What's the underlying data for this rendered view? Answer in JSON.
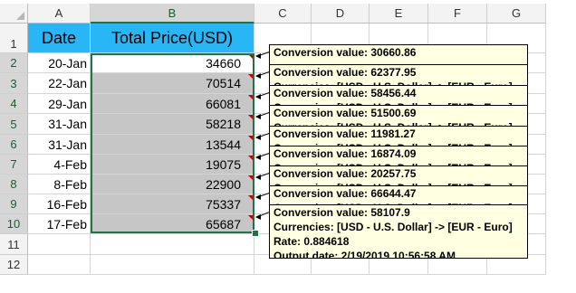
{
  "columns": [
    "A",
    "B",
    "C",
    "D",
    "E",
    "F",
    "G"
  ],
  "rows": [
    "1",
    "2",
    "3",
    "4",
    "5",
    "6",
    "7",
    "8",
    "9",
    "10",
    "11",
    "12"
  ],
  "header": {
    "date": "Date",
    "price": "Total Price(USD)"
  },
  "header_fill": "#29b6f6",
  "selection_color": "#217346",
  "table": [
    {
      "date": "20-Jan",
      "price": "34660"
    },
    {
      "date": "22-Jan",
      "price": "70514"
    },
    {
      "date": "29-Jan",
      "price": "66081"
    },
    {
      "date": "31-Jan",
      "price": "58218"
    },
    {
      "date": "31-Jan",
      "price": "13544"
    },
    {
      "date": "4-Feb",
      "price": "19075"
    },
    {
      "date": "8-Feb",
      "price": "22900"
    },
    {
      "date": "16-Feb",
      "price": "75337"
    },
    {
      "date": "17-Feb",
      "price": "65687"
    }
  ],
  "comments": [
    {
      "line1": "Conversion value: 30660.86",
      "line2": ""
    },
    {
      "line1": "Conversion value: 62377.95",
      "line2": "Currencies: [USD - U.S. Dollar] -> [EUR - Euro]"
    },
    {
      "line1": "Conversion value: 58456.44",
      "line2": "Currencies: [USD - U.S. Dollar] -> [EUR - Euro]"
    },
    {
      "line1": "Conversion value: 51500.69",
      "line2": "Currencies: [USD - U.S. Dollar] -> [EUR - Euro]"
    },
    {
      "line1": "Conversion value: 11981.27",
      "line2": "Currencies: [USD - U.S. Dollar] -> [EUR - Euro]"
    },
    {
      "line1": "Conversion value: 16874.09",
      "line2": "Currencies: [USD - U.S. Dollar] -> [EUR - Euro]"
    },
    {
      "line1": "Conversion value: 20257.75",
      "line2": "Currencies: [USD - U.S. Dollar] -> [EUR - Euro]"
    },
    {
      "line1": "Conversion value: 66644.47",
      "line2": "Currencies: [USD - U.S. Dollar] -> [EUR - Euro]"
    }
  ],
  "last_comment": {
    "line1": "Conversion value: 58107.9",
    "line2": "Currencies: [USD - U.S. Dollar] -> [EUR - Euro]",
    "line3": "Rate: 0.884618",
    "line4": "Output date: 2/19/2019 10:56:58 AM"
  }
}
